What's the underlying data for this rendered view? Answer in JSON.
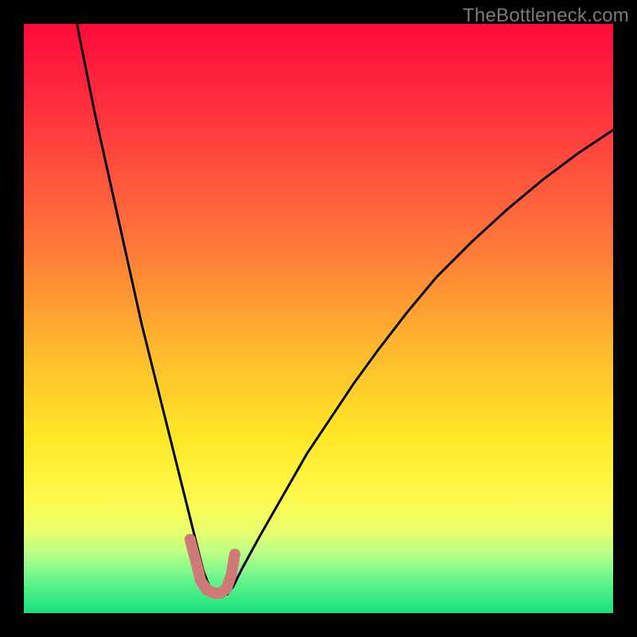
{
  "watermark": "TheBottleneck.com",
  "chart_data": {
    "type": "line",
    "title": "",
    "xlabel": "",
    "ylabel": "",
    "xlim": [
      0,
      100
    ],
    "ylim": [
      0,
      100
    ],
    "grid": false,
    "legend": false,
    "background_gradient_stops": [
      {
        "offset": 0,
        "color": "#ff0a3b"
      },
      {
        "offset": 18,
        "color": "#ff3b3f"
      },
      {
        "offset": 38,
        "color": "#ff7a39"
      },
      {
        "offset": 55,
        "color": "#ffb82e"
      },
      {
        "offset": 70,
        "color": "#ffe726"
      },
      {
        "offset": 80,
        "color": "#fff94a"
      },
      {
        "offset": 86,
        "color": "#e9ff6c"
      },
      {
        "offset": 90,
        "color": "#b8ff86"
      },
      {
        "offset": 94,
        "color": "#6cf58d"
      },
      {
        "offset": 100,
        "color": "#18e07b"
      }
    ],
    "series": [
      {
        "name": "bottleneck-curve",
        "stroke": "#000000",
        "stroke_width": 3,
        "x": [
          9,
          10,
          12,
          14,
          16,
          18,
          20,
          22,
          24,
          26,
          28,
          29.5,
          30.5,
          31.5,
          33,
          34.5,
          35.5,
          37,
          40,
          44,
          48,
          52,
          56,
          60,
          65,
          70,
          76,
          82,
          88,
          94,
          100
        ],
        "y": [
          100,
          95,
          85,
          76,
          67,
          58,
          49,
          41,
          33,
          25,
          17,
          11,
          7,
          4.5,
          3.2,
          3.2,
          4.5,
          7.5,
          13,
          20,
          27,
          33,
          39,
          44.5,
          51,
          57,
          63,
          68.5,
          73.5,
          78,
          82
        ]
      },
      {
        "name": "highlight-band",
        "stroke": "#cf7a78",
        "stroke_width": 14,
        "linecap": "round",
        "x": [
          28.2,
          29.4,
          30.0,
          31.0,
          32.2,
          33.4,
          34.4,
          35.2,
          35.8
        ],
        "y": [
          12.5,
          8.0,
          5.5,
          4.0,
          3.4,
          3.4,
          4.2,
          6.5,
          10.0
        ]
      }
    ],
    "annotations": []
  }
}
